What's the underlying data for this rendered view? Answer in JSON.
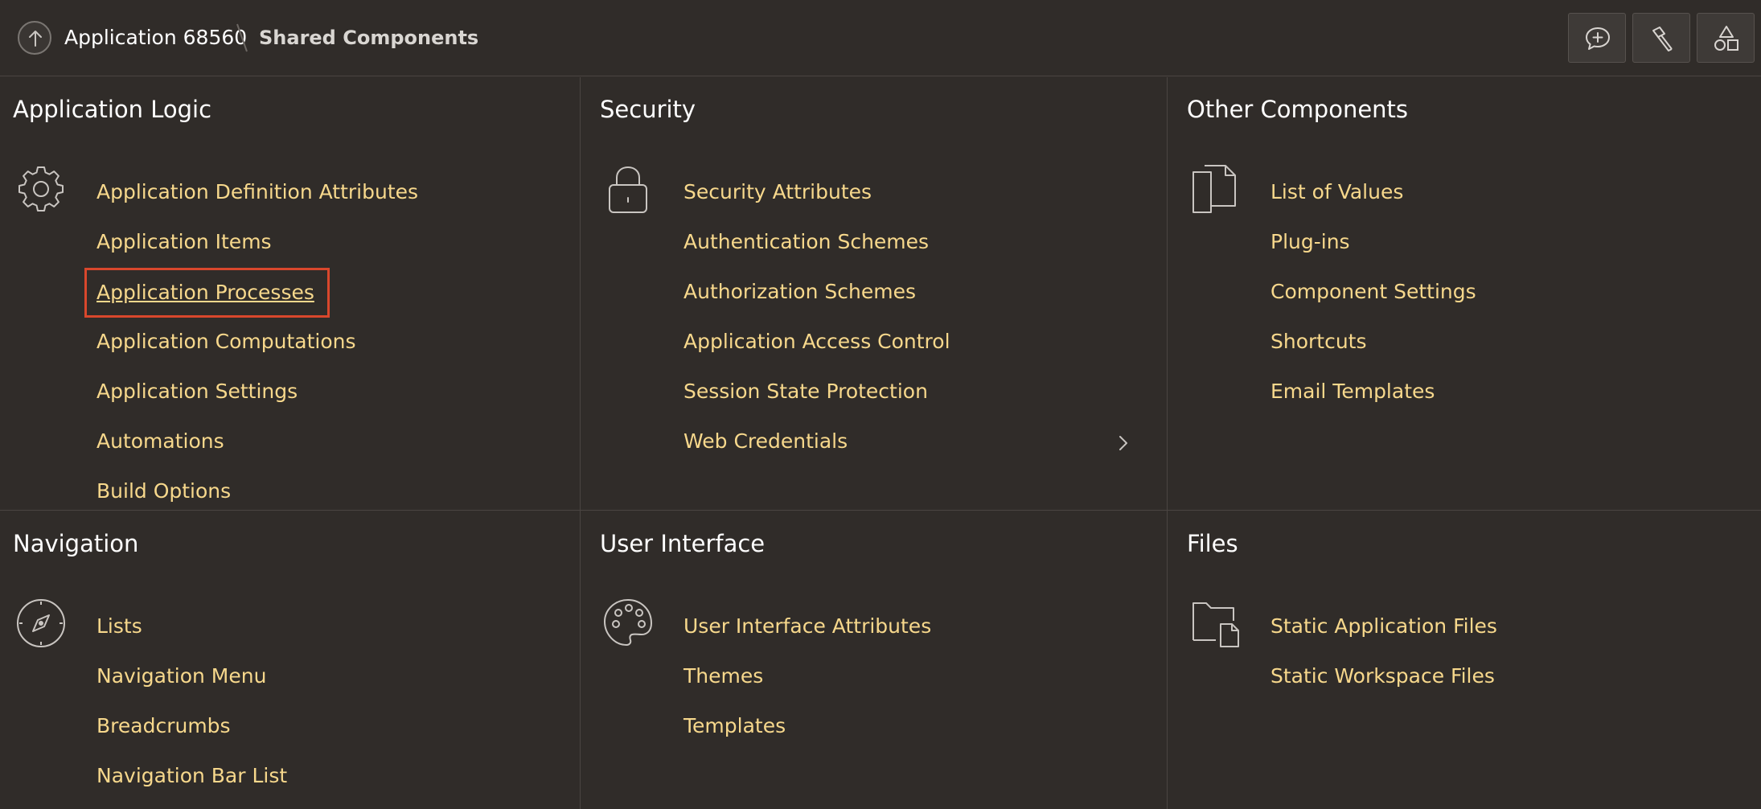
{
  "header": {
    "app_label": "Application 68560",
    "current_page": "Shared Components",
    "buttons": [
      {
        "icon": "add-comment-icon"
      },
      {
        "icon": "flashlight-icon"
      },
      {
        "icon": "shapes-icon"
      }
    ]
  },
  "colors": {
    "background": "#302c29",
    "link": "#f7d88c",
    "title": "#ffffff",
    "focus_outline": "#d9472c"
  },
  "sections": {
    "application_logic": {
      "title": "Application Logic",
      "icon": "gear-icon",
      "links": [
        "Application Definition Attributes",
        "Application Items",
        "Application Processes",
        "Application Computations",
        "Application Settings",
        "Automations",
        "Build Options"
      ],
      "highlighted": "Application Processes"
    },
    "security": {
      "title": "Security",
      "icon": "lock-icon",
      "links": [
        "Security Attributes",
        "Authentication Schemes",
        "Authorization Schemes",
        "Application Access Control",
        "Session State Protection",
        "Web Credentials"
      ]
    },
    "other_components": {
      "title": "Other Components",
      "icon": "documents-icon",
      "links": [
        "List of Values",
        "Plug-ins",
        "Component Settings",
        "Shortcuts",
        "Email Templates"
      ]
    },
    "navigation": {
      "title": "Navigation",
      "icon": "compass-icon",
      "links": [
        "Lists",
        "Navigation Menu",
        "Breadcrumbs",
        "Navigation Bar List"
      ]
    },
    "user_interface": {
      "title": "User Interface",
      "icon": "palette-icon",
      "links": [
        "User Interface Attributes",
        "Themes",
        "Templates"
      ]
    },
    "files": {
      "title": "Files",
      "icon": "folder-file-icon",
      "links": [
        "Static Application Files",
        "Static Workspace Files"
      ]
    }
  }
}
